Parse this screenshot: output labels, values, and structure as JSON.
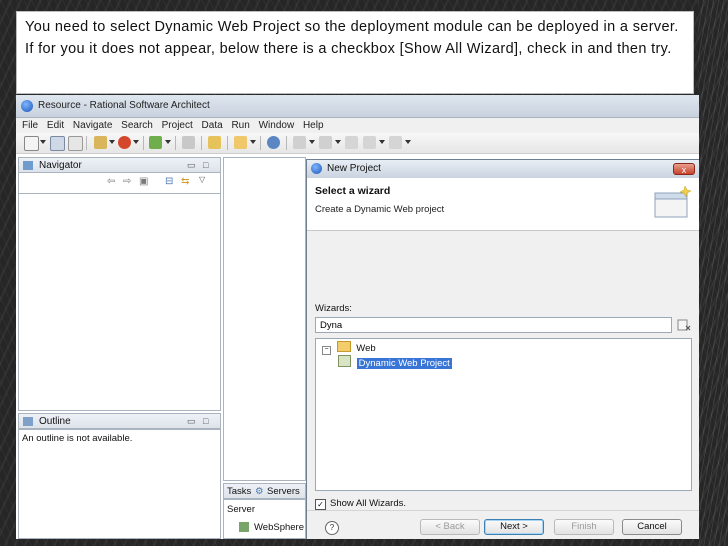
{
  "caption": {
    "text": "You need to select Dynamic Web Project so the deployment module can be deployed in a server. If for you it does not appear, below there is a checkbox [Show All Wizard], check in and then try."
  },
  "window": {
    "title": "Resource - Rational Software Architect"
  },
  "menu": [
    "File",
    "Edit",
    "Navigate",
    "Search",
    "Project",
    "Data",
    "Run",
    "Window",
    "Help"
  ],
  "toolbar": {
    "icons": [
      "new-icon",
      "save-icon",
      "print-icon",
      "run-icon",
      "debug-icon",
      "external-tools-icon",
      "search-icon",
      "open-type-icon",
      "pencil-icon",
      "folder-icon",
      "web-icon",
      "annotation-icon",
      "back-icon",
      "forward-icon"
    ]
  },
  "navigator": {
    "title": "Navigator"
  },
  "outline": {
    "title": "Outline",
    "message": "An outline is not available."
  },
  "bottom_tabs": {
    "tasks": "Tasks",
    "servers": "Servers",
    "server_header": "Server",
    "server_row": "WebSphere"
  },
  "dialog": {
    "title": "New Project",
    "close": "x",
    "header_title": "Select a wizard",
    "header_desc": "Create a Dynamic Web project",
    "wizards_label": "Wizards:",
    "filter_value": "Dyna",
    "tree": {
      "folder": "Web",
      "item": "Dynamic Web Project"
    },
    "show_all": {
      "label": "Show All Wizards.",
      "checked": true
    },
    "buttons": {
      "back": "< Back",
      "next": "Next >",
      "finish": "Finish",
      "cancel": "Cancel"
    },
    "help": "?"
  },
  "colors": {
    "selection": "#3875d7",
    "close_button": "#c7422a"
  }
}
